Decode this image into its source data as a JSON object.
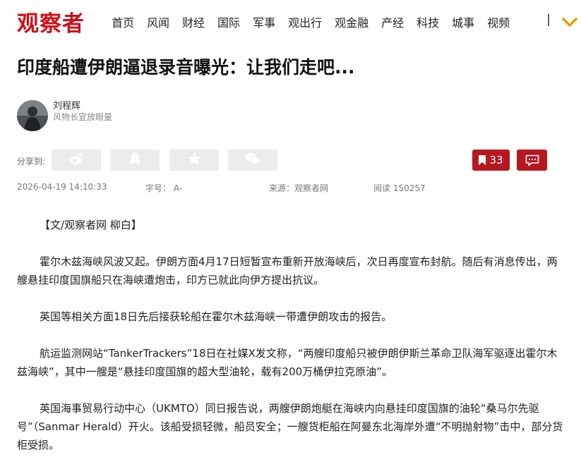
{
  "header": {
    "logo": "观察者",
    "nav": [
      "首页",
      "风闻",
      "财经",
      "国际",
      "军事",
      "观出行",
      "观金融",
      "产经",
      "科技",
      "城事",
      "视频"
    ],
    "separator": "|"
  },
  "article": {
    "title": "印度船遭伊朗逼退录音曝光：让我们走吧...",
    "author": {
      "name": "刘程辉",
      "desc": "风物长宜放眼量"
    },
    "share": {
      "label": "分享到:",
      "icons": [
        "weibo-icon",
        "qq-icon",
        "qzone-icon",
        "wechat-icon"
      ]
    },
    "favorite_count": "33",
    "meta": {
      "datetime": "2026-04-19 14:10:33",
      "font_size": "字号：  A-",
      "source": "来源：观察者网",
      "reads": "阅读 150257"
    },
    "paragraphs": [
      "【文/观察者网 柳白】",
      "霍尔木兹海峡风波又起。伊朗方面4月17日短暂宣布重新开放海峡后，次日再度宣布封航。随后有消息传出，两艘悬挂印度国旗船只在海峡遭炮击，印方已就此向伊方提出抗议。",
      "英国等相关方面18日先后接获轮船在霍尔木兹海峡一带遭伊朗攻击的报告。",
      "航运监测网站“TankerTrackers”18日在社媒X发文称，“两艘印度船只被伊朗伊斯兰革命卫队海军驱逐出霍尔木兹海峡”，其中一艘是“悬挂印度国旗的超大型油轮，载有200万桶伊拉克原油”。",
      "英国海事贸易行动中心（UKMTO）同日报告说，两艘伊朗炮艇在海峡内向悬挂印度国旗的油轮“桑马尔先驱号”（Sanmar Herald）开火。该船受损轻微，船员安全；一艘货柜船在阿曼东北海岸外遭“不明抛射物”击中，部分货柜受损。"
    ]
  },
  "colors": {
    "brand": "#d10f1a",
    "button": "#b71820",
    "more_arrow": "#e5a100"
  }
}
